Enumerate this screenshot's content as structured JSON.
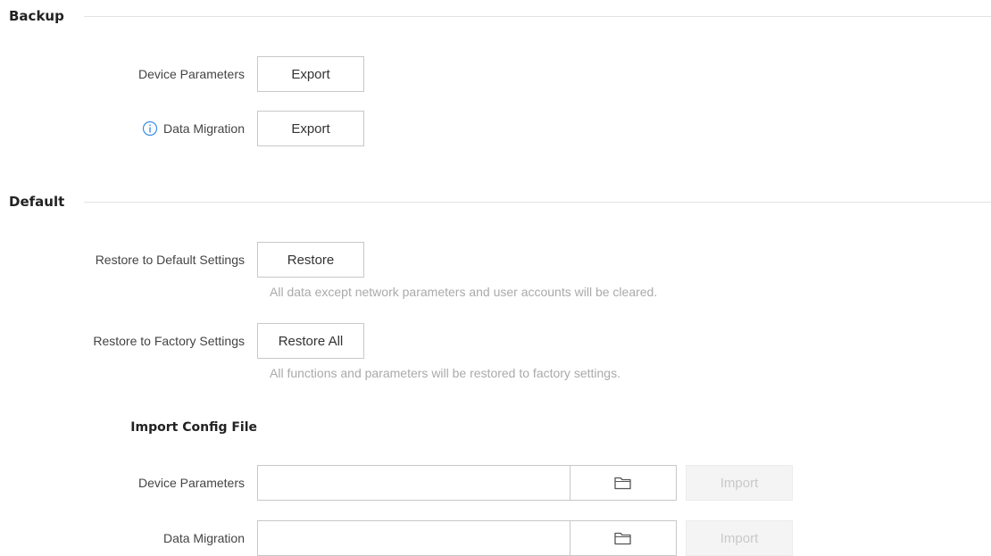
{
  "backup": {
    "title": "Backup",
    "device_parameters": {
      "label": "Device Parameters",
      "button": "Export"
    },
    "data_migration": {
      "label": "Data Migration",
      "button": "Export",
      "icon": "info-icon"
    }
  },
  "default": {
    "title": "Default",
    "restore_default": {
      "label": "Restore to Default Settings",
      "button": "Restore",
      "hint": "All data except network parameters and user accounts will be cleared."
    },
    "restore_factory": {
      "label": "Restore to Factory Settings",
      "button": "Restore All",
      "hint": "All functions and parameters will be restored to factory settings."
    },
    "import": {
      "title": "Import Config File",
      "device_parameters": {
        "label": "Device Parameters",
        "value": "",
        "browse_icon": "folder-icon",
        "button": "Import"
      },
      "data_migration": {
        "label": "Data Migration",
        "value": "",
        "browse_icon": "folder-icon",
        "button": "Import"
      }
    }
  },
  "colors": {
    "info_accent": "#3a8ee6",
    "disabled_text": "#c9c9c9",
    "hint_text": "#aaaaaa"
  }
}
